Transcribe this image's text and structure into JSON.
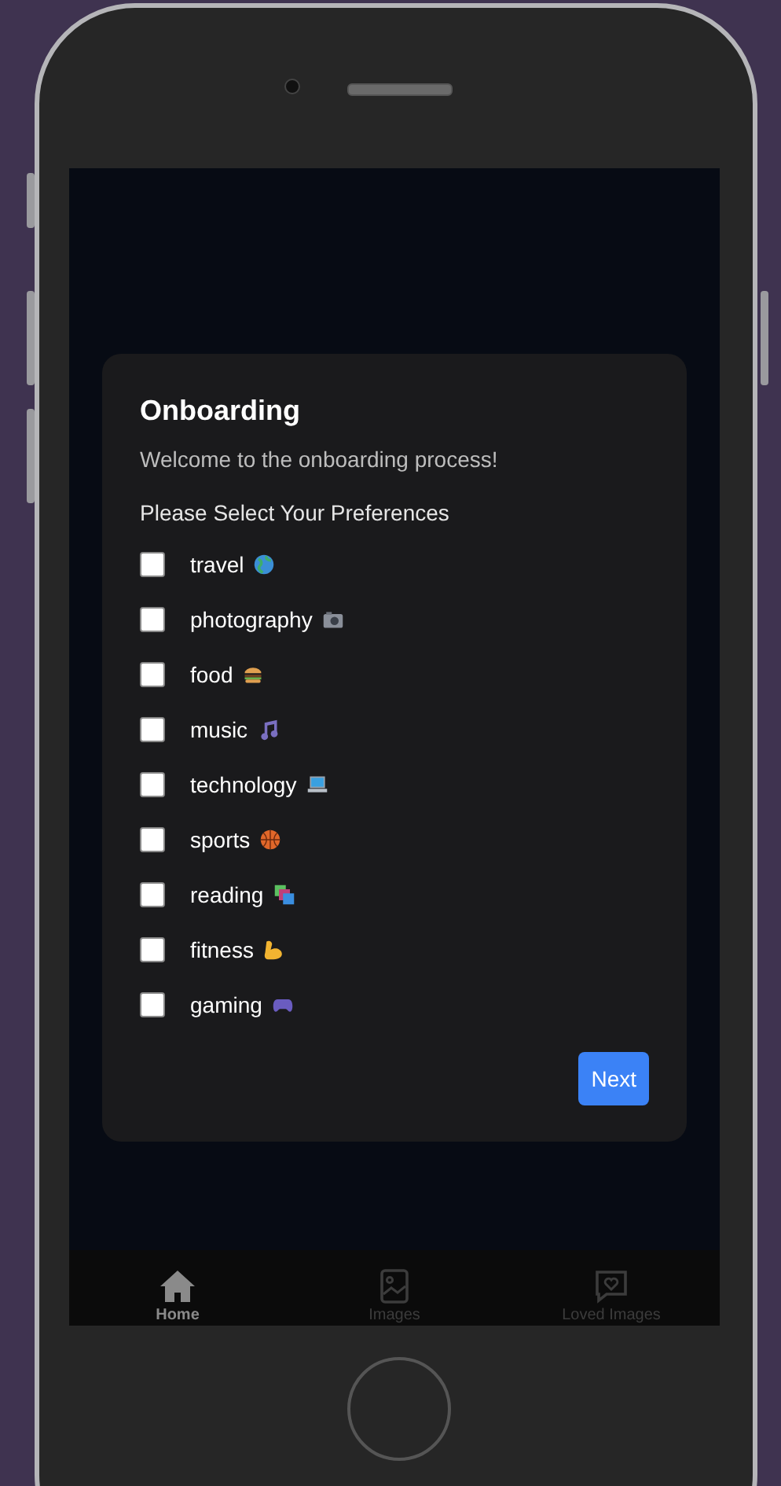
{
  "card": {
    "title": "Onboarding",
    "subtitle": "Welcome to the onboarding process!",
    "prompt": "Please Select Your Preferences",
    "preferences": [
      {
        "label": "travel",
        "kind": "globe",
        "checked": false
      },
      {
        "label": "photography",
        "kind": "camera",
        "checked": false
      },
      {
        "label": "food",
        "kind": "burger",
        "checked": false
      },
      {
        "label": "music",
        "kind": "note",
        "checked": false
      },
      {
        "label": "technology",
        "kind": "laptop",
        "checked": false
      },
      {
        "label": "sports",
        "kind": "ball",
        "checked": false
      },
      {
        "label": "reading",
        "kind": "books",
        "checked": false
      },
      {
        "label": "fitness",
        "kind": "arm",
        "checked": false
      },
      {
        "label": "gaming",
        "kind": "gamepad",
        "checked": false
      }
    ],
    "button": "Next"
  },
  "nav": [
    {
      "label": "Home",
      "kind": "home",
      "selected": true
    },
    {
      "label": "Images",
      "kind": "image",
      "selected": false
    },
    {
      "label": "Loved Images",
      "kind": "heart",
      "selected": false
    }
  ]
}
